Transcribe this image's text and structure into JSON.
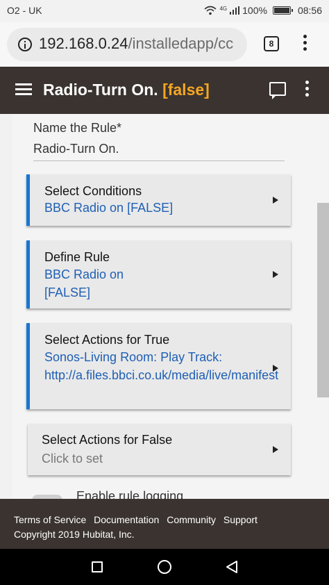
{
  "status_bar": {
    "carrier": "O2 - UK",
    "network": "4G",
    "battery": "100%",
    "time": "08:56"
  },
  "browser": {
    "url_host": "192.168.0.24",
    "url_path": "/installedapp/cc",
    "tab_count": "8"
  },
  "header": {
    "title": "Radio-Turn On.",
    "status_flag": "[false]"
  },
  "form": {
    "name_label": "Name the Rule*",
    "name_value": "Radio-Turn On.",
    "sections": [
      {
        "title": "Select Conditions",
        "value": "BBC Radio on [FALSE]"
      },
      {
        "title": "Define Rule",
        "value_line1": "BBC Radio on",
        "value_line2": "[FALSE]"
      },
      {
        "title": "Select Actions for True",
        "value_line1": "Sonos-Living Room: Play Track:",
        "value_line2": "http://a.files.bbci.co.uk/media/live/manifest"
      },
      {
        "title": "Select Actions for False",
        "value": "Click to set"
      }
    ],
    "logging_label": "Enable rule logging"
  },
  "footer": {
    "links": [
      "Terms of Service",
      "Documentation",
      "Community",
      "Support"
    ],
    "copyright": "Copyright 2019 Hubitat, Inc."
  },
  "colors": {
    "header_bg": "#3a3330",
    "accent": "#1976d2",
    "flag": "#f5a623",
    "link_text": "#1e5fb4"
  }
}
